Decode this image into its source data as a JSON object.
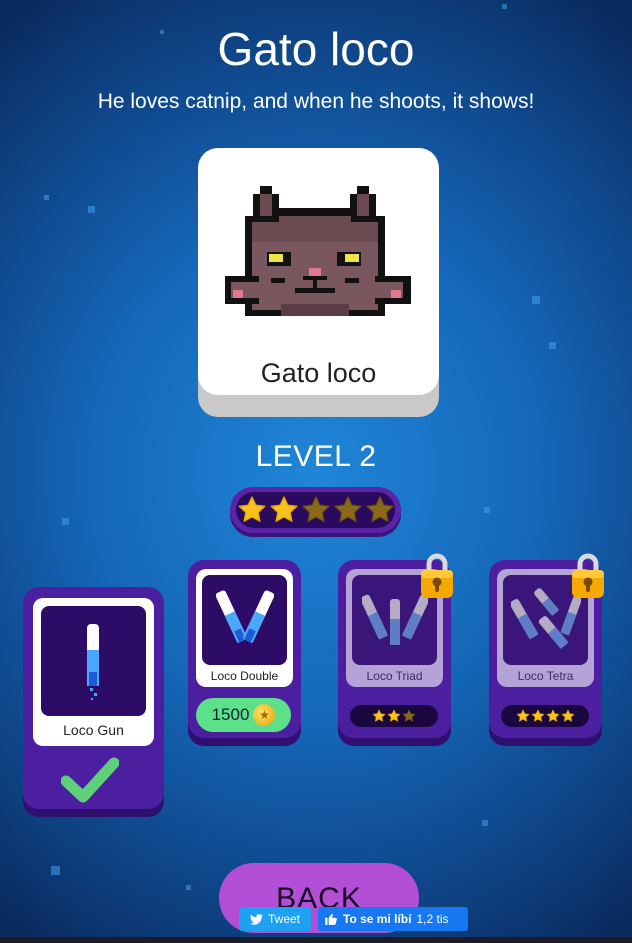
{
  "header": {
    "title": "Gato loco",
    "subtitle": "He loves catnip, and when he shoots, it shows!"
  },
  "character": {
    "name": "Gato loco",
    "level_label": "LEVEL 2",
    "stars_filled": 2,
    "stars_total": 5
  },
  "weapons": [
    {
      "name": "Loco Gun",
      "state": "equipped",
      "icon": "checkmark-icon"
    },
    {
      "name": "Loco Double",
      "state": "purchasable",
      "price": "1500",
      "icon": "coin-icon"
    },
    {
      "name": "Loco Triad",
      "state": "locked",
      "required_stars": 3,
      "icon": "padlock-icon"
    },
    {
      "name": "Loco Tetra",
      "state": "locked",
      "required_stars": 4,
      "icon": "padlock-icon"
    }
  ],
  "back_button": {
    "label": "BACK"
  },
  "share": {
    "tweet_label": "Tweet",
    "facebook_label": "To se mi líbí",
    "facebook_count": "1,2 tis"
  },
  "colors": {
    "accent_purple": "#4b1fa0",
    "star_gold": "#f7c21a",
    "star_empty": "#8a6a1a",
    "price_green": "#5de08a",
    "back_button": "#b34fd6"
  }
}
